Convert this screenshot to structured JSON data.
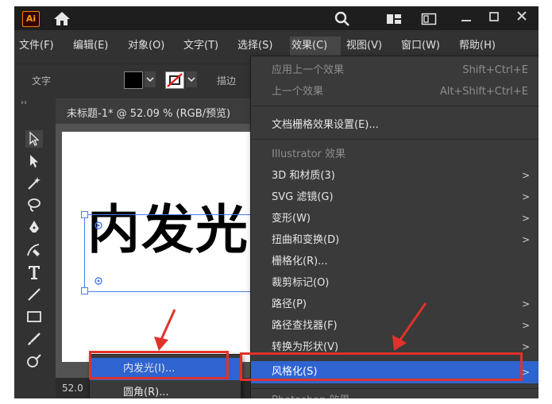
{
  "titlebar": {
    "logo_text": "Ai"
  },
  "menubar": {
    "items": [
      {
        "label": "文件(F)"
      },
      {
        "label": "编辑(E)"
      },
      {
        "label": "对象(O)"
      },
      {
        "label": "文字(T)"
      },
      {
        "label": "选择(S)"
      },
      {
        "label": "效果(C)",
        "active": true
      },
      {
        "label": "视图(V)"
      },
      {
        "label": "窗口(W)"
      },
      {
        "label": "帮助(H)"
      }
    ]
  },
  "controlbar": {
    "type_label": "文字",
    "stroke_label": "描边"
  },
  "document": {
    "tab_title": "未标题-1* @ 52.09 % (RGB/预览)",
    "zoom": "52.0",
    "art_text": "内发光"
  },
  "effect_menu": {
    "apply_last": {
      "label": "应用上一个效果",
      "shortcut": "Shift+Ctrl+E"
    },
    "last": {
      "label": "上一个效果",
      "shortcut": "Alt+Shift+Ctrl+E"
    },
    "raster_settings": "文档栅格效果设置(E)...",
    "illustrator_section": "Illustrator 效果",
    "items": [
      {
        "label": "3D 和材质(3)",
        "submenu": true
      },
      {
        "label": "SVG 滤镜(G)",
        "submenu": true
      },
      {
        "label": "变形(W)",
        "submenu": true
      },
      {
        "label": "扭曲和变换(D)",
        "submenu": true
      },
      {
        "label": "栅格化(R)...",
        "submenu": false
      },
      {
        "label": "裁剪标记(O)",
        "submenu": false
      },
      {
        "label": "路径(P)",
        "submenu": true
      },
      {
        "label": "路径查找器(F)",
        "submenu": true
      },
      {
        "label": "转换为形状(V)",
        "submenu": true
      },
      {
        "label": "风格化(S)",
        "submenu": true,
        "highlight": true
      }
    ],
    "photoshop_section": "Photoshop 效果"
  },
  "submenu": {
    "items": [
      {
        "label": "内发光(I)..."
      },
      {
        "label": "圆角(R)..."
      }
    ]
  },
  "colors": {
    "highlight": "#2f64d0",
    "annotation_red": "#e0322b",
    "app_bg": "#323232"
  }
}
